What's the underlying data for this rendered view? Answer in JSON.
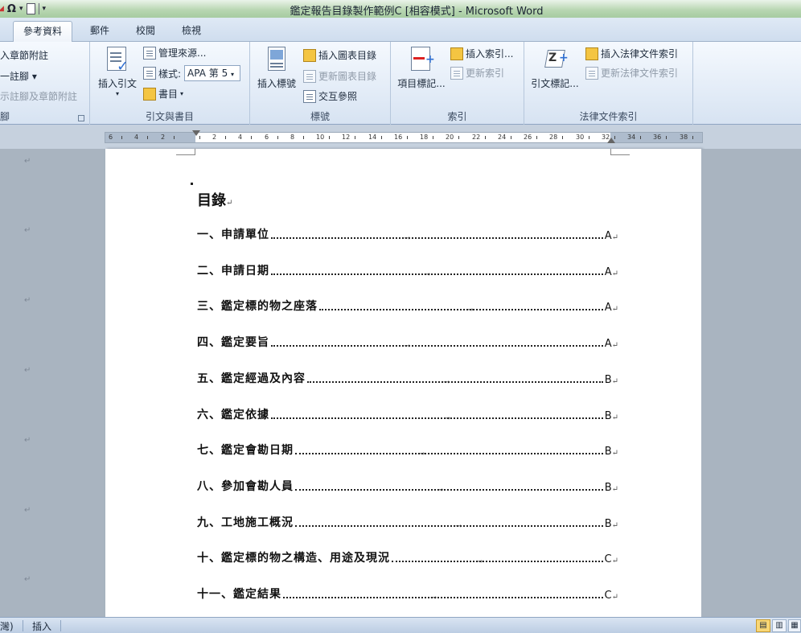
{
  "titlebar": {
    "title": "鑑定報告目錄製作範例C [相容模式] - Microsoft Word",
    "qat_omega": "Ω",
    "qat_dropdown": "▾"
  },
  "tabs": [
    {
      "label": "參考資料",
      "active": true
    },
    {
      "label": "郵件"
    },
    {
      "label": "校閱"
    },
    {
      "label": "檢視"
    }
  ],
  "ribbon": {
    "footnotes": {
      "insert_endnote": "入章節附註",
      "next_footnote": "一註腳 ▾",
      "show_notes": "示註腳及章節附註",
      "group_label": "腳"
    },
    "citations": {
      "insert_citation": "插入引文",
      "manage_sources": "管理來源...",
      "style_label": "樣式:",
      "style_value": "APA 第 5",
      "bibliography": "書目",
      "group_label": "引文與書目"
    },
    "captions": {
      "insert_caption": "插入標號",
      "insert_table_of_figures": "插入圖表目錄",
      "update_table": "更新圖表目錄",
      "cross_reference": "交互參照",
      "group_label": "標號"
    },
    "index": {
      "mark_entry": "項目標記...",
      "insert_index": "插入索引...",
      "update_index": "更新索引",
      "group_label": "索引"
    },
    "authorities": {
      "mark_citation": "引文標記...",
      "insert_table_of_authorities": "插入法律文件索引",
      "update_table": "更新法律文件索引",
      "group_label": "法律文件索引"
    }
  },
  "ruler": {
    "numbers": [
      "6",
      "4",
      "2",
      "",
      "2",
      "4",
      "6",
      "8",
      "10",
      "12",
      "14",
      "16",
      "18",
      "20",
      "22",
      "24",
      "26",
      "28",
      "30",
      "32",
      "34",
      "36",
      "38"
    ]
  },
  "document": {
    "toc_title": "目錄",
    "paragraph_mark": "↵",
    "tab_arrow": "→",
    "entries": [
      {
        "label": "一、申請單位",
        "page": "A"
      },
      {
        "label": "二、申請日期",
        "page": "A"
      },
      {
        "label": "三、鑑定標的物之座落",
        "page": "A"
      },
      {
        "label": "四、鑑定要旨",
        "page": "A"
      },
      {
        "label": "五、鑑定經過及內容",
        "page": "B"
      },
      {
        "label": "六、鑑定依據",
        "page": "B"
      },
      {
        "label": "七、鑑定會勘日期",
        "page": "B"
      },
      {
        "label": "八、參加會勘人員",
        "page": "B"
      },
      {
        "label": "九、工地施工概況",
        "page": "B"
      },
      {
        "label": "十、鑑定標的物之構造、用途及現況",
        "page": "C"
      },
      {
        "label": "十一、鑑定結果",
        "page": "C"
      }
    ]
  },
  "statusbar": {
    "language": "灣)",
    "mode": "插入"
  }
}
